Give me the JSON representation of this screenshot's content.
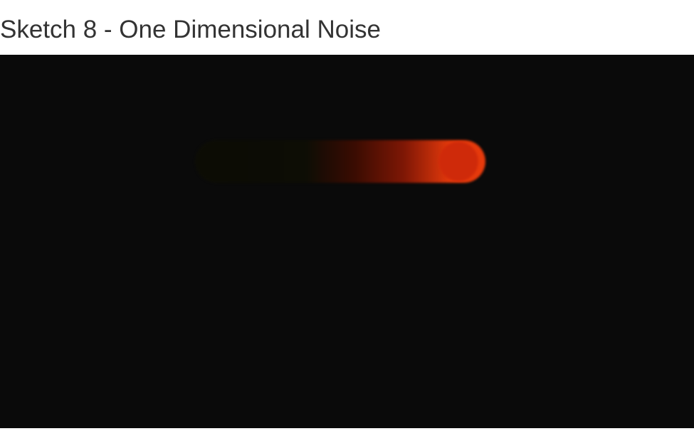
{
  "page": {
    "title": "Sketch 8 - One Dimensional Noise"
  },
  "sketch": {
    "background_color": "#0a0a0a",
    "trail_color_start": "#0d0d05",
    "trail_color_end": "#e63a0c",
    "dot_color": "#cf2a0a"
  }
}
